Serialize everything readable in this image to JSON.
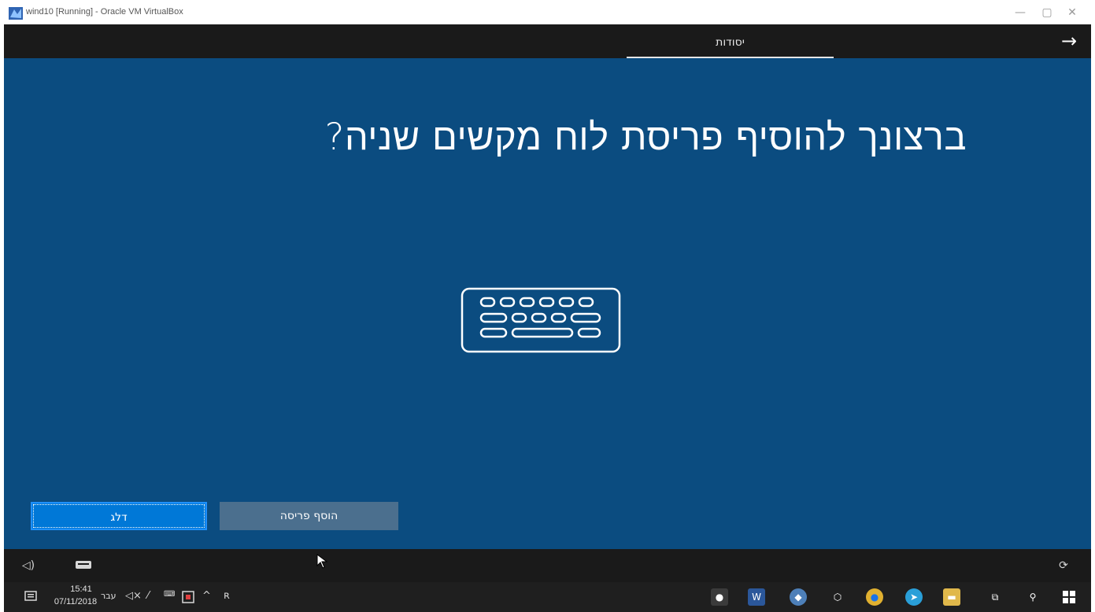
{
  "window": {
    "title": "wind10 [Running] - Oracle VM VirtualBox",
    "icon": "virtualbox-icon",
    "controls": [
      "minimize-icon",
      "restore-icon",
      "close-icon"
    ]
  },
  "oobe": {
    "tab_label": "יסודות",
    "next_icon": "arrow-right-icon",
    "question": "ברצונך להוסיף פריסת לוח מקשים שניה?",
    "illustration_icon": "keyboard-icon",
    "buttons": {
      "skip_label": "דלג",
      "add_layout_label": "הוסף פריסה"
    },
    "bottom_bar_icons": [
      "volume-icon",
      "on-screen-keyboard-icon",
      "accessibility-icon"
    ]
  },
  "taskbar": {
    "clock_time": "15:41",
    "clock_date": "07/11/2018",
    "language": "עבר",
    "tray_icons": [
      "notification-center-icon",
      "volume-muted-icon",
      "network-icon",
      "keyboard-layout-icon",
      "action-icon",
      "show-hidden-icons-icon",
      "people-icon"
    ],
    "pinned_apps": [
      "paint-icon",
      "word-icon",
      "app-icon",
      "virtualbox-icon",
      "chrome-icon",
      "telegram-icon",
      "file-explorer-icon",
      "task-view-icon",
      "search-icon",
      "start-icon"
    ]
  }
}
